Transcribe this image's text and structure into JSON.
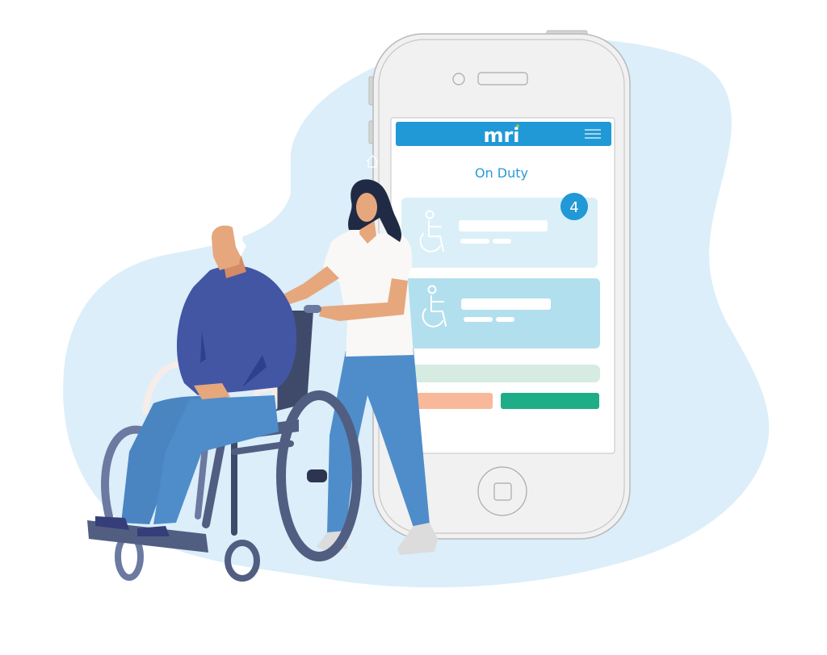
{
  "app": {
    "logo_text": "mri",
    "screen_title": "On Duty",
    "menu_icon": "hamburger-menu-icon",
    "badge_count": "4"
  },
  "cards": [
    {
      "icon": "wheelchair-icon",
      "state": "light"
    },
    {
      "icon": "wheelchair-icon",
      "state": "highlighted"
    }
  ],
  "colors": {
    "background_blob": "#dbeef9",
    "header_blue": "#2199d6",
    "title_blue": "#2a9ad6",
    "badge_blue": "#2199d6",
    "card_light": "#dbeff8",
    "card_highlight": "#b2dfee",
    "progress_bar": "#d6ebe1",
    "button_cancel": "#f8b99a",
    "button_confirm": "#1fad87",
    "logo_accent": "#a4c93a",
    "phone_body": "#f1f1f1",
    "phone_outline": "#b9b9b9",
    "sweater": "#4356a4",
    "pants": "#4f8dca",
    "skin": "#e6a77d",
    "hair_dark": "#202a44",
    "wheelchair": "#515e82",
    "shirt": "#f9f8f6"
  }
}
